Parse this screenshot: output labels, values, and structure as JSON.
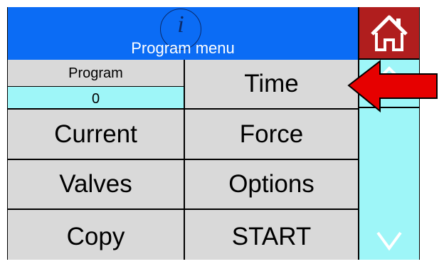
{
  "header": {
    "title": "Program menu",
    "info_icon": "info-icon",
    "home_icon": "home-icon"
  },
  "program": {
    "label": "Program",
    "value": "0"
  },
  "buttons": {
    "time": "Time",
    "current": "Current",
    "force": "Force",
    "valves": "Valves",
    "options": "Options",
    "copy": "Copy",
    "start": "START"
  },
  "scrollbar": {
    "up_icon": "chevron-up-icon",
    "down_icon": "chevron-down-icon"
  },
  "annotation": {
    "icon": "red-arrow-icon"
  },
  "colors": {
    "header_bg": "#0b6cf5",
    "home_bg": "#b01e1e",
    "accent_cyan": "#9ef6f8",
    "button_bg": "#d9d9d9",
    "arrow": "#e60000"
  }
}
